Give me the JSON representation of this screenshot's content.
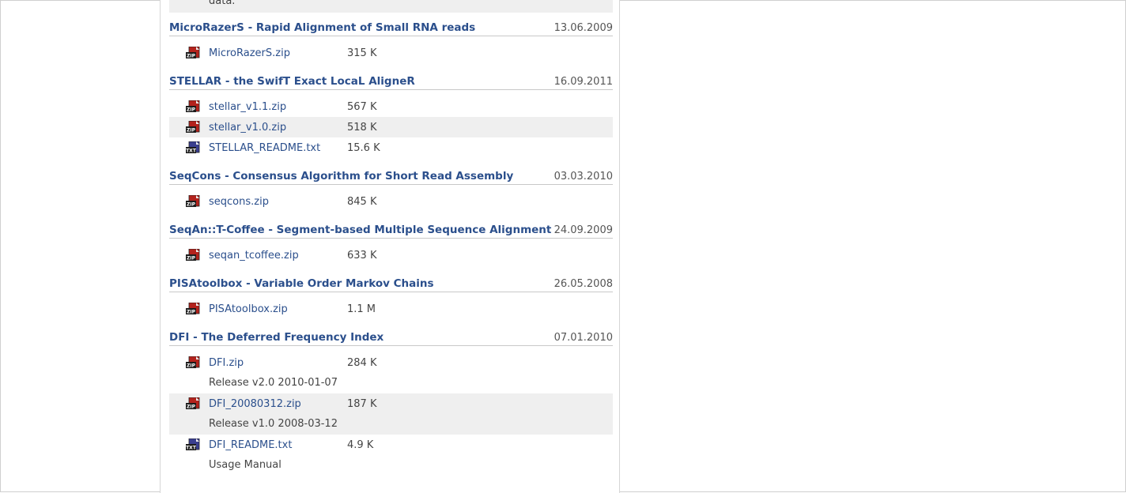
{
  "top_remnant": "data.",
  "sections": [
    {
      "title": "MicroRazerS - Rapid Alignment of Small RNA reads",
      "date": "13.06.2009",
      "files": [
        {
          "icon": "zip-file-icon",
          "name": "MicroRazerS.zip",
          "size": "315 K"
        }
      ]
    },
    {
      "title": "STELLAR - the SwifT Exact LocaL AligneR",
      "date": "16.09.2011",
      "files": [
        {
          "icon": "zip-file-icon",
          "name": "stellar_v1.1.zip",
          "size": "567 K"
        },
        {
          "icon": "zip-file-icon",
          "name": "stellar_v1.0.zip",
          "size": "518 K"
        },
        {
          "icon": "txt-file-icon",
          "name": "STELLAR_README.txt",
          "size": "15.6 K"
        }
      ]
    },
    {
      "title": "SeqCons - Consensus Algorithm for Short Read Assembly",
      "date": "03.03.2010",
      "files": [
        {
          "icon": "zip-file-icon",
          "name": "seqcons.zip",
          "size": "845 K"
        }
      ]
    },
    {
      "title": "SeqAn::T-Coffee - Segment-based Multiple Sequence Alignment",
      "date": "24.09.2009",
      "files": [
        {
          "icon": "zip-file-icon",
          "name": "seqan_tcoffee.zip",
          "size": "633 K"
        }
      ]
    },
    {
      "title": "PISAtoolbox - Variable Order Markov Chains",
      "date": "26.05.2008",
      "files": [
        {
          "icon": "zip-file-icon",
          "name": "PISAtoolbox.zip",
          "size": "1.1 M"
        }
      ]
    },
    {
      "title": "DFI - The Deferred Frequency Index",
      "date": "07.01.2010",
      "files": [
        {
          "icon": "zip-file-icon",
          "name": "DFI.zip",
          "size": "284 K",
          "desc": "Release v2.0 2010-01-07"
        },
        {
          "icon": "zip-file-icon",
          "name": "DFI_20080312.zip",
          "size": "187 K",
          "desc": "Release v1.0 2008-03-12"
        },
        {
          "icon": "txt-file-icon",
          "name": "DFI_README.txt",
          "size": "4.9 K",
          "desc": "Usage Manual"
        }
      ]
    }
  ],
  "colors": {
    "link": "#2b4f8c",
    "zip_icon": "#b3221c",
    "txt_icon": "#3a3f8f",
    "alt_row": "#efefef"
  }
}
